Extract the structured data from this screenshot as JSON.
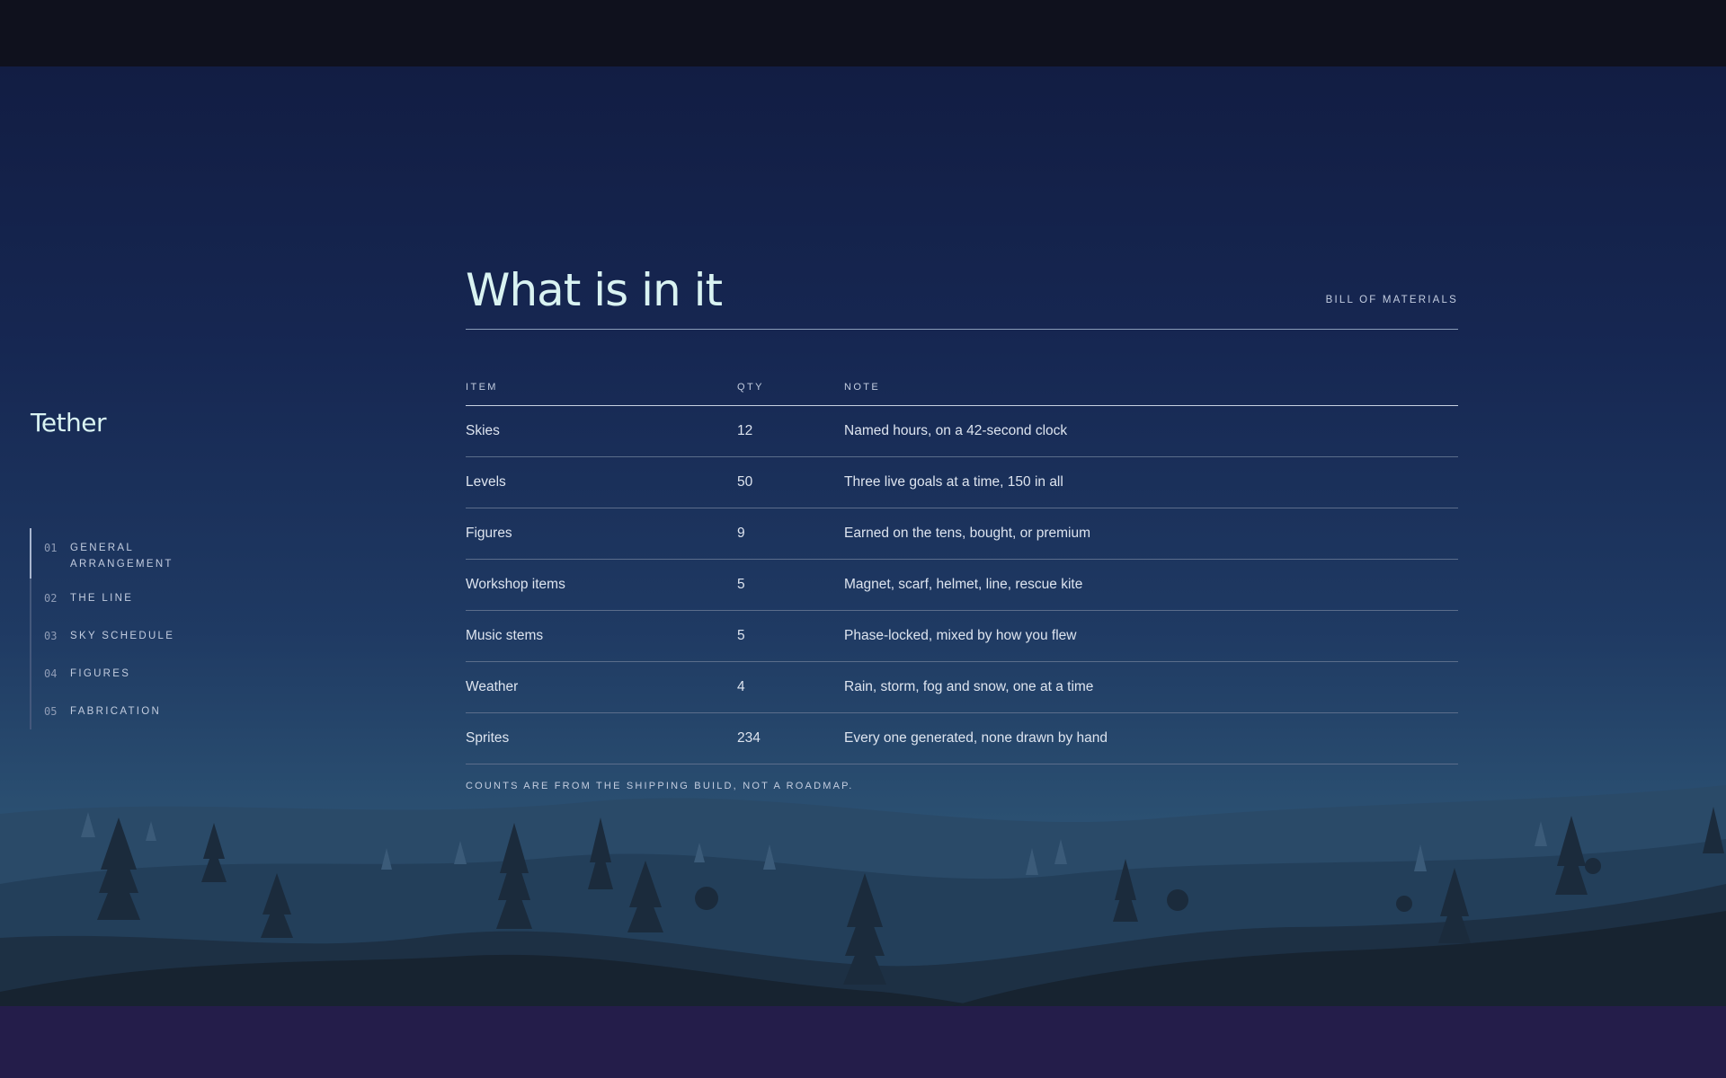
{
  "sidebar": {
    "title": "Tether",
    "items": [
      {
        "num": "01",
        "label": "GENERAL ARRANGEMENT",
        "active": true
      },
      {
        "num": "02",
        "label": "THE LINE"
      },
      {
        "num": "03",
        "label": "SKY SCHEDULE"
      },
      {
        "num": "04",
        "label": "FIGURES"
      },
      {
        "num": "05",
        "label": "FABRICATION"
      }
    ]
  },
  "main": {
    "title": "What is in it",
    "eyebrow": "BILL OF MATERIALS",
    "table": {
      "headers": [
        "ITEM",
        "QTY",
        "NOTE"
      ],
      "rows": [
        {
          "item": "Skies",
          "qty": "12",
          "note": "Named hours, on a 42-second clock"
        },
        {
          "item": "Levels",
          "qty": "50",
          "note": "Three live goals at a time, 150 in all"
        },
        {
          "item": "Figures",
          "qty": "9",
          "note": "Earned on the tens, bought, or premium"
        },
        {
          "item": "Workshop items",
          "qty": "5",
          "note": "Magnet, scarf, helmet, line, rescue kite"
        },
        {
          "item": "Music stems",
          "qty": "5",
          "note": "Phase-locked, mixed by how you flew"
        },
        {
          "item": "Weather",
          "qty": "4",
          "note": "Rain, storm, fog and snow, one at a time"
        },
        {
          "item": "Sprites",
          "qty": "234",
          "note": "Every one generated, none drawn by hand"
        }
      ]
    },
    "footnote": "COUNTS ARE FROM THE SHIPPING BUILD, NOT A ROADMAP."
  },
  "colors": {
    "sky_top": "#121d43",
    "sky_bottom": "#2e5677",
    "title": "#d9f3f2",
    "top_bar": "#0f111d",
    "bottom_bar": "#241d4a"
  }
}
